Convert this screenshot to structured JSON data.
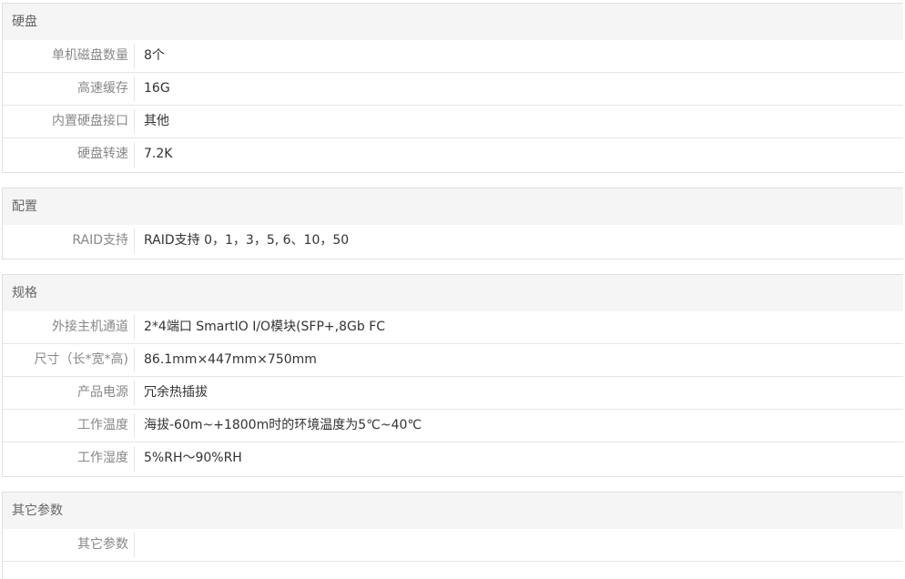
{
  "sections": {
    "disk": {
      "title": "硬盘",
      "rows": [
        {
          "label": "单机磁盘数量",
          "value": "8个"
        },
        {
          "label": "高速缓存",
          "value": "16G"
        },
        {
          "label": "内置硬盘接口",
          "value": "其他"
        },
        {
          "label": "硬盘转速",
          "value": "7.2K"
        }
      ]
    },
    "config": {
      "title": "配置",
      "rows": [
        {
          "label": "RAID支持",
          "value": "RAID支持 0，1，3，5, 6、10，50"
        }
      ]
    },
    "spec": {
      "title": "规格",
      "rows": [
        {
          "label": "外接主机通道",
          "value": "2*4端口 SmartIO I/O模块(SFP+,8Gb FC"
        },
        {
          "label": "尺寸（长*宽*高)",
          "value": "86.1mm×447mm×750mm"
        },
        {
          "label": "产品电源",
          "value": "冗余热插拔"
        },
        {
          "label": "工作温度",
          "value": "海拔-60m~+1800m时的环境温度为5℃~40℃"
        },
        {
          "label": "工作湿度",
          "value": "5%RH～90%RH"
        }
      ]
    },
    "other": {
      "title": "其它参数",
      "rows": [
        {
          "label": "其它参数",
          "value": ""
        }
      ]
    }
  }
}
